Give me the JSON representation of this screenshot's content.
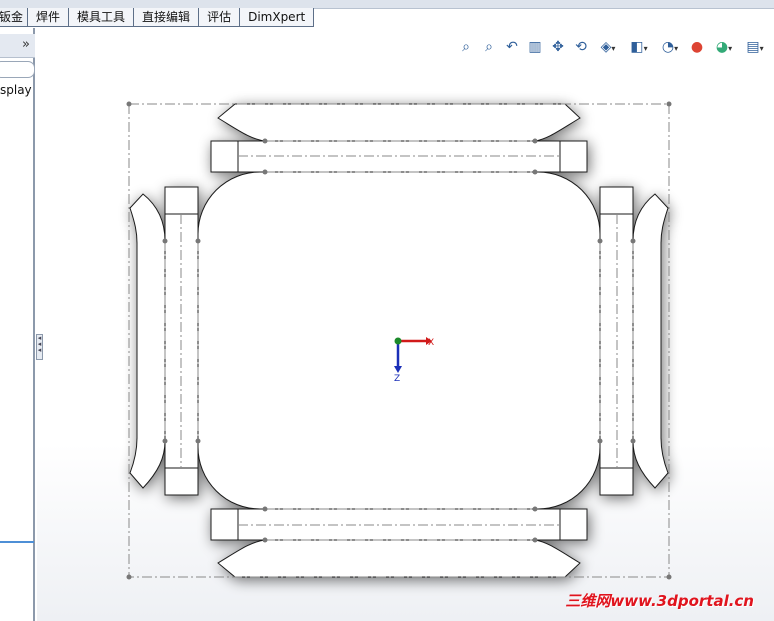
{
  "command_manager": {
    "tabs": [
      {
        "label": "钣金"
      },
      {
        "label": "焊件"
      },
      {
        "label": "模具工具"
      },
      {
        "label": "直接编辑"
      },
      {
        "label": "评估"
      },
      {
        "label": "DimXpert"
      }
    ]
  },
  "left_pane": {
    "collapse_glyph": "»",
    "display_label": "splay"
  },
  "heads_up_toolbar": {
    "icons": [
      "zoom-to-fit-icon",
      "zoom-to-area-icon",
      "previous-view-icon",
      "section-view-icon",
      "pan-icon",
      "rotate-icon",
      "view-orientation-icon",
      "display-style-icon",
      "hide-show-items-icon",
      "edit-appearance-icon",
      "apply-scene-icon",
      "view-settings-icon"
    ]
  },
  "triad": {
    "x_label": "X",
    "z_label": "Z",
    "colors": {
      "x": "#d11a1a",
      "z": "#1a2fb8",
      "origin": "#1b8a2a"
    }
  },
  "drawing": {
    "stroke_color": "#1a1a1a",
    "centerline_color": "#8a8a8a"
  },
  "watermark": {
    "text": "三维网www.3dportal.cn",
    "color": "#e0141e"
  }
}
